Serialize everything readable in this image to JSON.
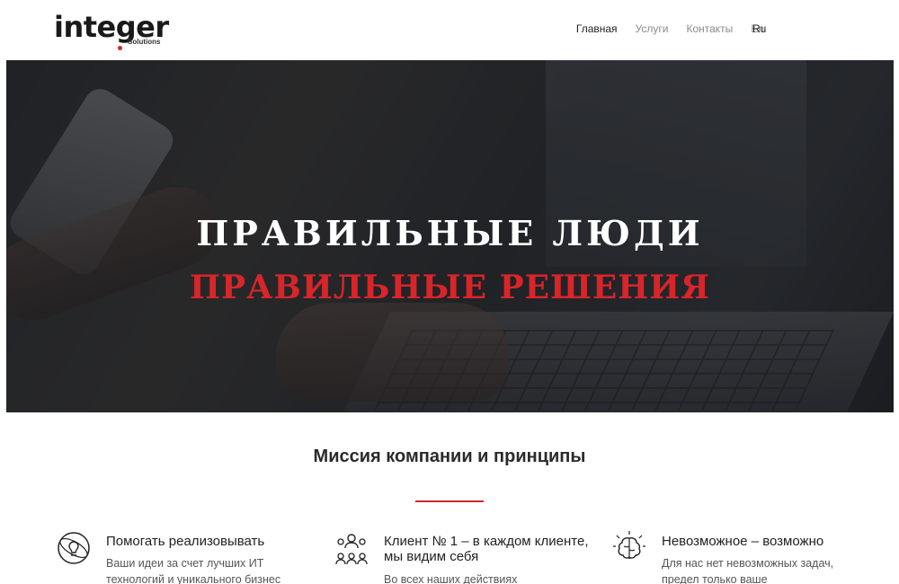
{
  "header": {
    "logo_word": "integer",
    "logo_sub": "Solutions",
    "nav": [
      {
        "label": "Главная",
        "active": true
      },
      {
        "label": "Услуги",
        "active": false
      },
      {
        "label": "Контакты",
        "active": false
      },
      {
        "label": "En",
        "active": false
      }
    ],
    "lang_ru": "Ru"
  },
  "hero": {
    "line1": "ПРАВИЛЬНЫЕ ЛЮДИ",
    "line2": "ПРАВИЛЬНЫЕ РЕШЕНИЯ"
  },
  "mission": {
    "title": "Миссия компании и принципы",
    "features": [
      {
        "icon": "lightbulb-icon",
        "title": "Помогать реализовывать",
        "text": "Ваши идеи за счет лучших ИТ технологий и уникального бизнес"
      },
      {
        "icon": "people-network-icon",
        "title": "Клиент № 1 – в каждом клиенте, мы видим себя",
        "text": "Во всех наших действиях"
      },
      {
        "icon": "brain-icon",
        "title": "Невозможное – возможно",
        "text": "Для нас нет невозможных задач, предел только ваше"
      }
    ]
  },
  "colors": {
    "accent": "#d8252a",
    "hero_text": "#ffffff"
  }
}
